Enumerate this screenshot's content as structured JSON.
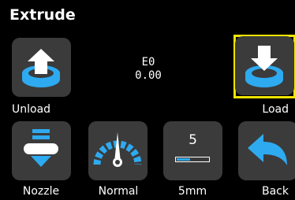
{
  "screen": {
    "title": "Extrude"
  },
  "readout": {
    "extruder": "E0",
    "length": "0.00"
  },
  "buttons": {
    "unload": {
      "label": "Unload",
      "icon": "unload-icon"
    },
    "load": {
      "label": "Load",
      "icon": "load-icon",
      "selected": true
    },
    "nozzle": {
      "label": "Nozzle",
      "icon": "nozzle-icon"
    },
    "speed": {
      "label": "Normal",
      "icon": "speedometer-icon"
    },
    "step": {
      "label": "5mm",
      "value": "5",
      "bar_fill": 0.4,
      "icon": "step-distance-icon"
    },
    "back": {
      "label": "Back",
      "icon": "back-arrow-icon"
    }
  },
  "colors": {
    "accent": "#2eaaf0",
    "button_bg": "#3b3b3b",
    "selection": "#f2e400",
    "background": "#000000"
  }
}
